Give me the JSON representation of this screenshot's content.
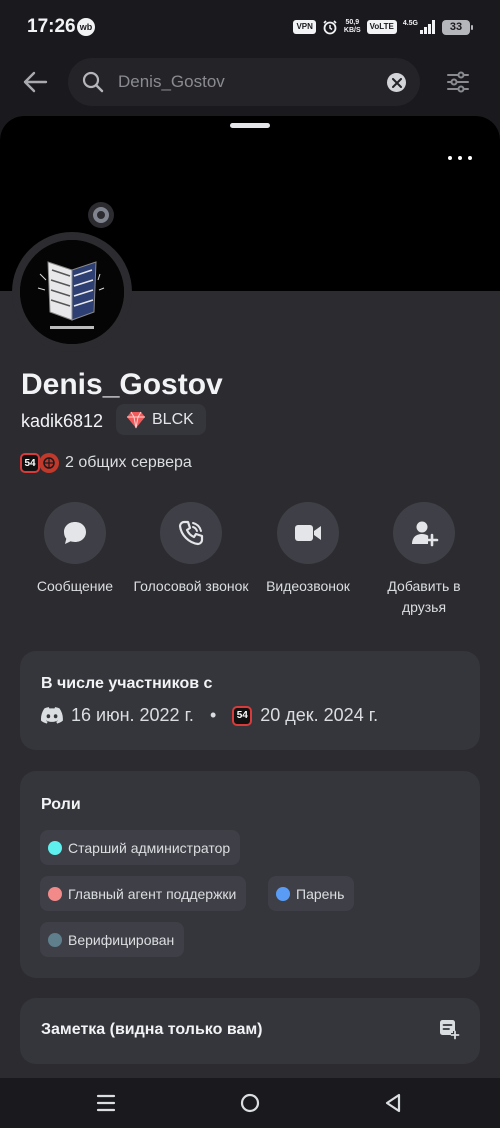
{
  "status_bar": {
    "time": "17:26",
    "app_badge": "wb",
    "vpn": "VPN",
    "speed_value": "50,9",
    "speed_unit": "KB/S",
    "volte": "VoLTE",
    "network": "4.5G",
    "battery": "33"
  },
  "search": {
    "value": "Denis_Gostov"
  },
  "profile": {
    "display_name": "Denis_Gostov",
    "username": "kadik6812",
    "tag": "BLCK",
    "mutual_servers": "2 общих сервера",
    "server_badge": "54"
  },
  "actions": [
    {
      "label": "Сообщение",
      "icon": "chat-bubble-icon"
    },
    {
      "label": "Голосовой звонок",
      "icon": "phone-icon"
    },
    {
      "label": "Видеозвонок",
      "icon": "video-camera-icon"
    },
    {
      "label": "Добавить в друзья",
      "icon": "add-friend-icon"
    }
  ],
  "member_since": {
    "title": "В числе участников с",
    "discord_date": "16 июн. 2022 г.",
    "separator": "•",
    "server_date": "20 дек. 2024 г."
  },
  "roles": {
    "title": "Роли",
    "items": [
      {
        "name": "Старший администратор",
        "color": "#5ef0ee"
      },
      {
        "name": "Главный агент поддержки",
        "color": "#f28a8a"
      },
      {
        "name": "Парень",
        "color": "#5a9cf5"
      },
      {
        "name": "Верифицирован",
        "color": "#5f7f8c"
      }
    ]
  },
  "note": {
    "title": "Заметка (видна только вам)"
  },
  "colors": {
    "background": "#1a1a1e",
    "sheet": "#2b2b30",
    "card": "#35363c",
    "banner": "#000000"
  }
}
